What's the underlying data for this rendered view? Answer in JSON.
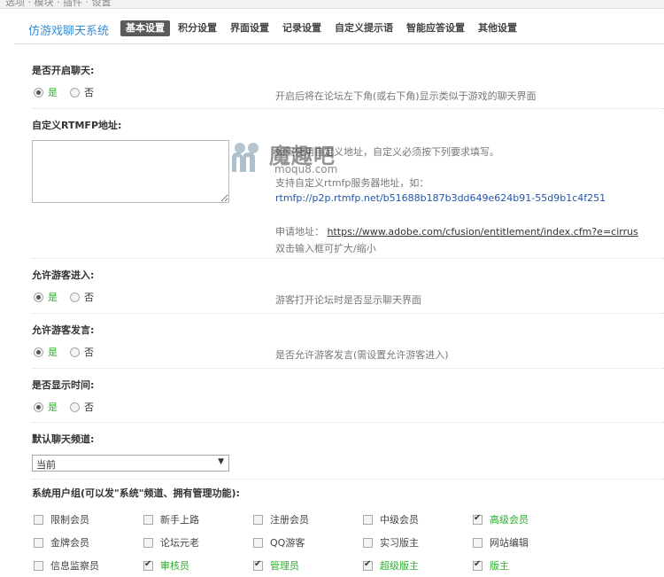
{
  "top_strip": {
    "text": "选项 · 模块 · 插件 · 设置"
  },
  "header": {
    "title": "仿游戏聊天系统",
    "tabs": [
      {
        "label": "基本设置",
        "active": true
      },
      {
        "label": "积分设置"
      },
      {
        "label": "界面设置"
      },
      {
        "label": "记录设置"
      },
      {
        "label": "自定义提示语"
      },
      {
        "label": "智能应答设置"
      },
      {
        "label": "其他设置"
      }
    ]
  },
  "sections": {
    "enable_chat": {
      "label": "是否开启聊天:",
      "yes": "是",
      "no": "否",
      "selected": "yes",
      "desc": "开启后将在论坛左下角(或右下角)显示类似于游戏的聊天界面"
    },
    "rtmfp": {
      "label": "自定义RTMFP地址:",
      "textarea_value": "",
      "desc_line1": "如需使用自定义地址，自定义必须按下列要求填写。",
      "desc_line2": "支持自定义rtmfp服务器地址，如：",
      "example": "rtmfp://p2p.rtmfp.net/b51688b187b3dd649e624b91-55d9b1c4f251",
      "apply_label": "申请地址：",
      "apply_url": "https://www.adobe.com/cfusion/entitlement/index.cfm?e=cirrus",
      "hint": "双击输入框可扩大/缩小"
    },
    "allow_guest": {
      "label": "允许游客进入:",
      "yes": "是",
      "no": "否",
      "selected": "yes",
      "desc": "游客打开论坛时是否显示聊天界面"
    },
    "allow_guest_speak": {
      "label": "允许游客发言:",
      "yes": "是",
      "no": "否",
      "selected": "yes",
      "desc": "是否允许游客发言(需设置允许游客进入)"
    },
    "show_time": {
      "label": "是否显示时间:",
      "yes": "是",
      "no": "否",
      "selected": "yes"
    },
    "default_channel": {
      "label": "默认聊天频道:",
      "selected": "当前"
    },
    "system_groups": {
      "label": "系统用户组(可以发\"系统\"频道、拥有管理功能):",
      "items": [
        {
          "label": "限制会员",
          "checked": false
        },
        {
          "label": "新手上路",
          "checked": false
        },
        {
          "label": "注册会员",
          "checked": false
        },
        {
          "label": "中级会员",
          "checked": false
        },
        {
          "label": "高级会员",
          "checked": true
        },
        {
          "label": "金牌会员",
          "checked": false
        },
        {
          "label": "论坛元老",
          "checked": false
        },
        {
          "label": "QQ游客",
          "checked": false
        },
        {
          "label": "实习版主",
          "checked": false
        },
        {
          "label": "网站编辑",
          "checked": false
        },
        {
          "label": "信息监察员",
          "checked": false
        },
        {
          "label": "审核员",
          "checked": true
        },
        {
          "label": "管理员",
          "checked": true
        },
        {
          "label": "超级版主",
          "checked": true
        },
        {
          "label": "版主",
          "checked": true
        }
      ]
    }
  },
  "watermark": {
    "text": "魔趣吧",
    "sub": "moqu8.com"
  },
  "colors": {
    "accent": "#3a8ed6",
    "checked_label": "#2fae2f",
    "tab_active_bg": "#5a5a5a"
  }
}
